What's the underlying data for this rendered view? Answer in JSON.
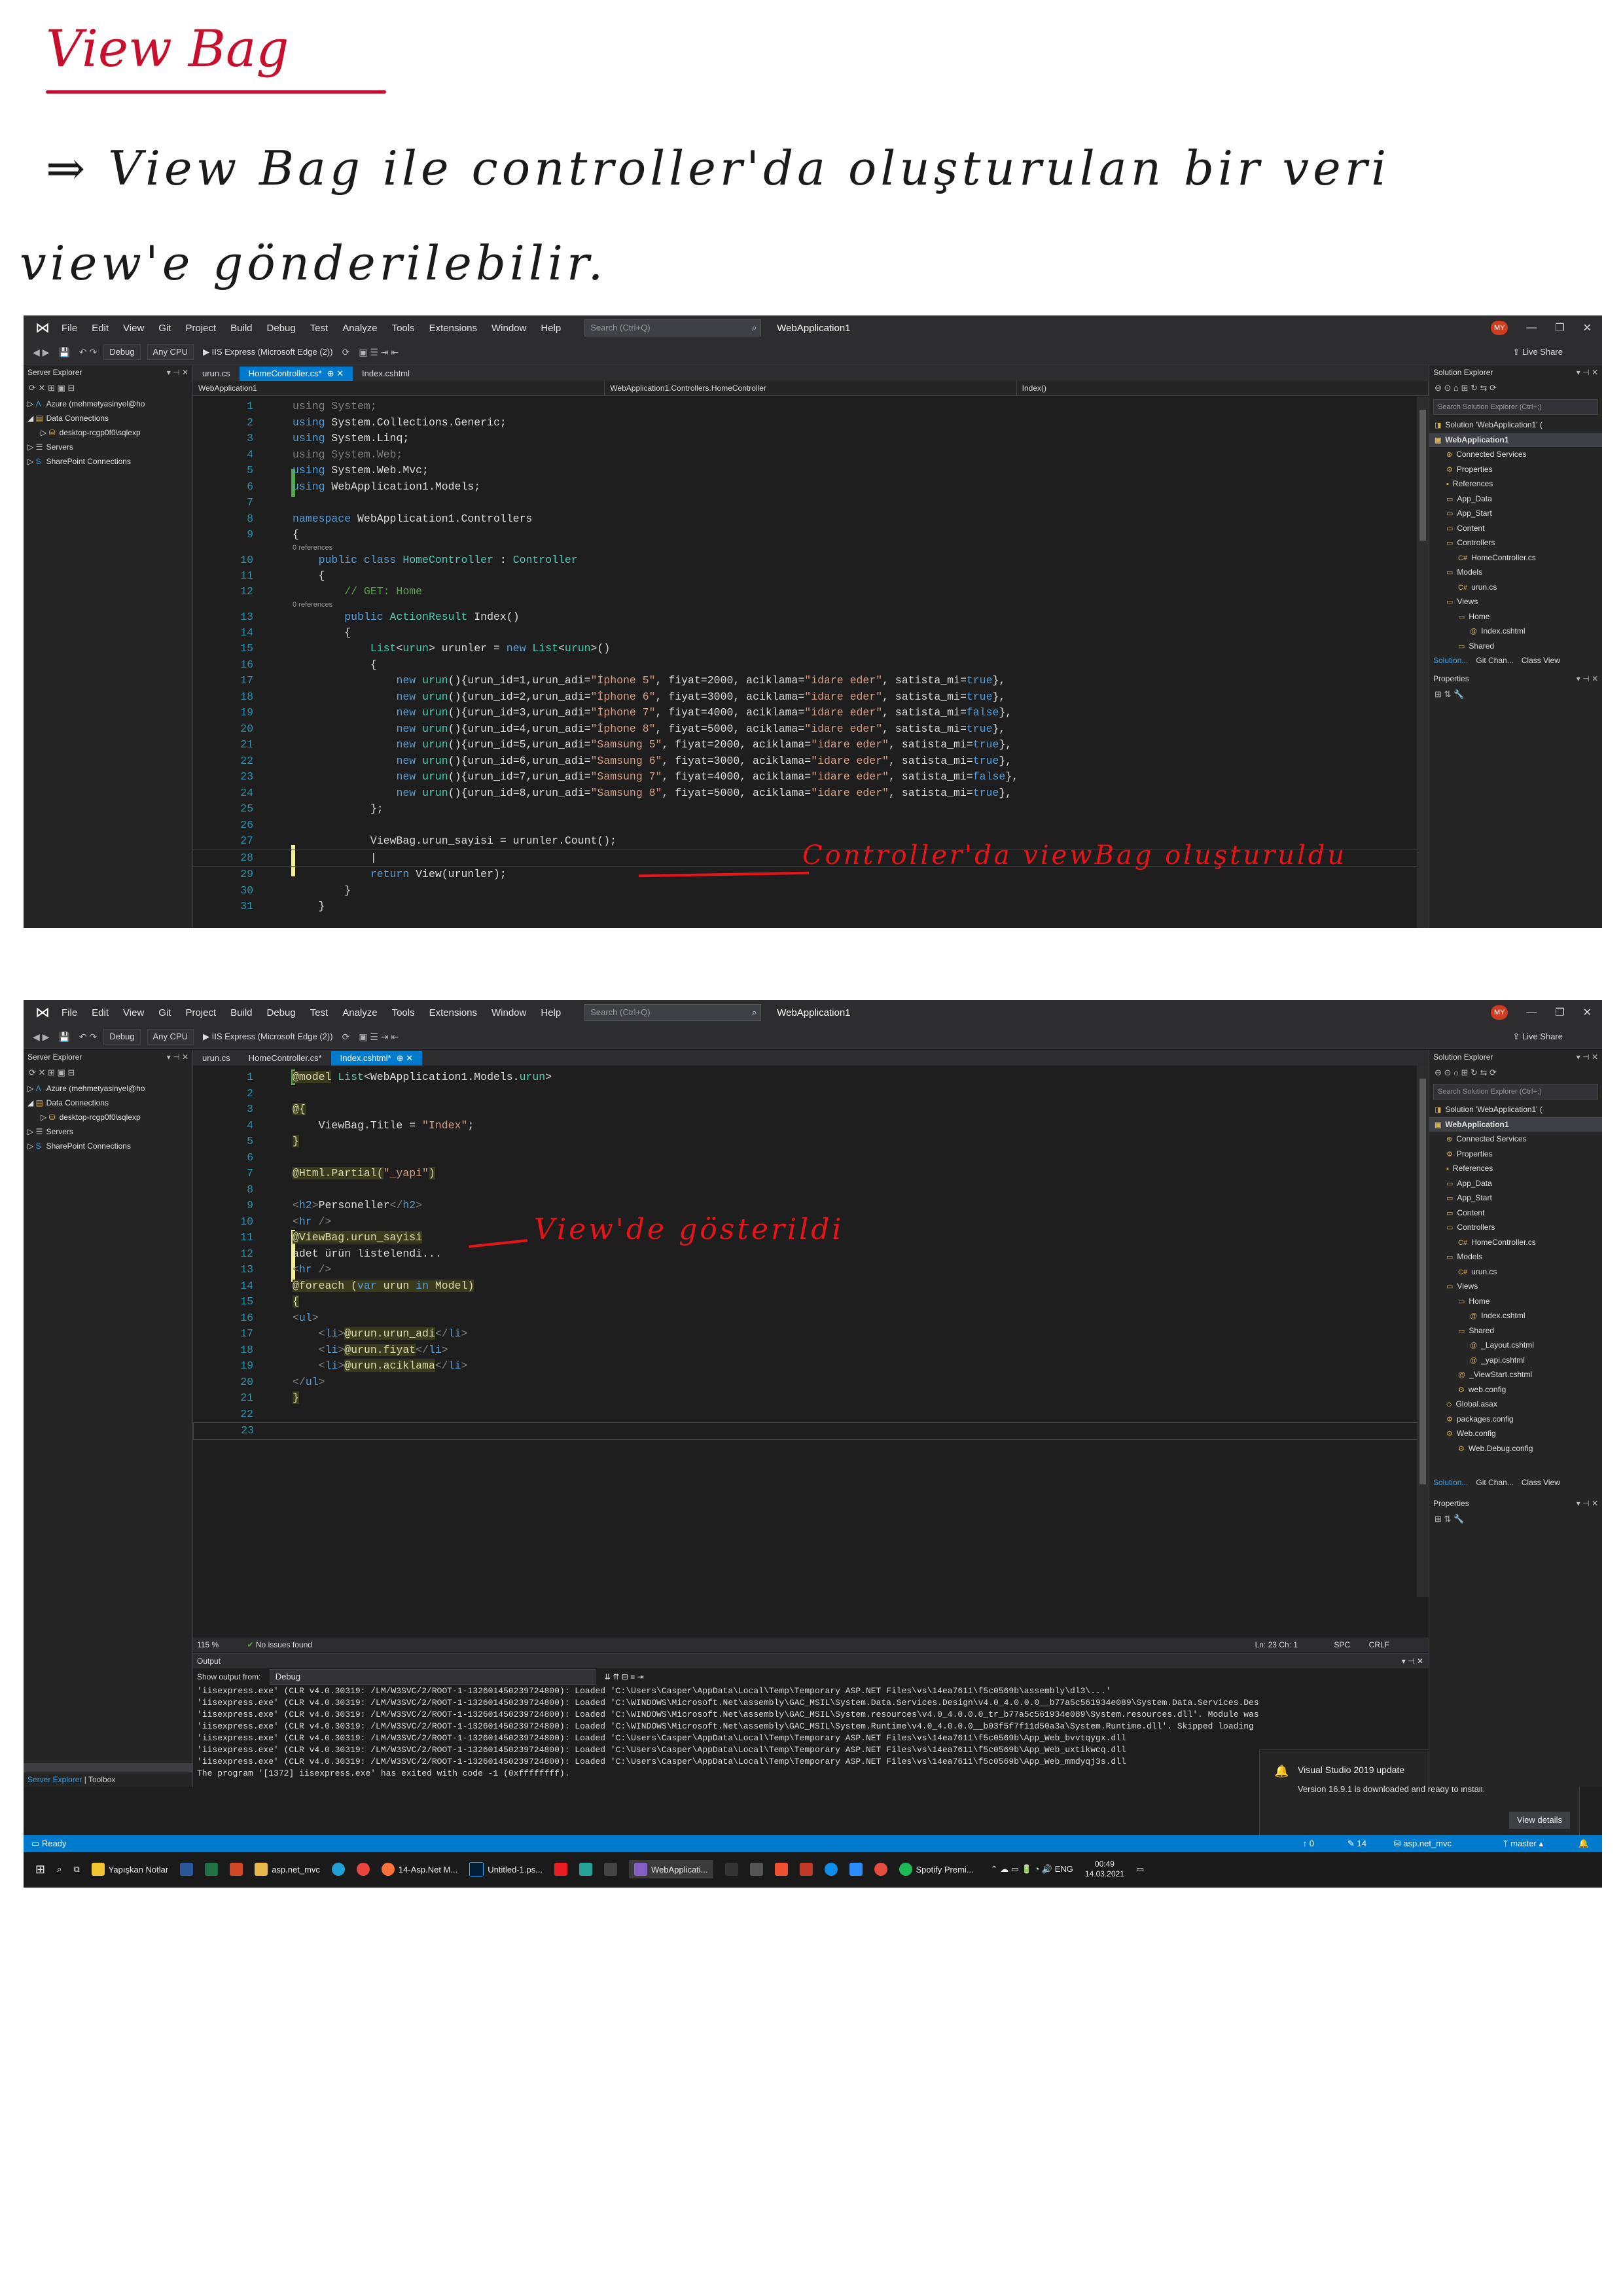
{
  "notes": {
    "title": "View Bag",
    "line1": "⇒ View Bag  ile   controller'da  oluşturulan  bir  veri",
    "line2": "view'e  gönderilebilir."
  },
  "menu": [
    "File",
    "Edit",
    "View",
    "Git",
    "Project",
    "Build",
    "Debug",
    "Test",
    "Analyze",
    "Tools",
    "Extensions",
    "Window",
    "Help"
  ],
  "search_placeholder": "Search (Ctrl+Q)",
  "app_title": "WebApplication1",
  "avatar": "MY",
  "toolbar": {
    "config": "Debug",
    "platform": "Any CPU",
    "run": "IIS Express (Microsoft Edge (2))",
    "live_share": "Live Share"
  },
  "server_explorer": {
    "title": "Server Explorer",
    "items": [
      "Azure (mehmetyasinyel@ho",
      "Data Connections",
      "desktop-rcgp0f0\\sqlexp",
      "Servers",
      "SharePoint Connections"
    ]
  },
  "solution_explorer": {
    "title": "Solution Explorer",
    "search": "Search Solution Explorer (Ctrl+;)",
    "items": [
      "Solution 'WebApplication1' (",
      "WebApplication1",
      "Connected Services",
      "Properties",
      "References",
      "App_Data",
      "App_Start",
      "Content",
      "Controllers",
      "HomeController.cs",
      "Models",
      "urun.cs",
      "Views",
      "Home",
      "Index.cshtml",
      "Shared",
      "_Layout.cshtml",
      "_yapi.cshtml",
      "_ViewStart.cshtml",
      "web.config",
      "Global.asax",
      "packages.config",
      "Web.config",
      "Web.Debug.config"
    ],
    "tabs": [
      "Solution...",
      "Git Chan...",
      "Class View"
    ],
    "properties": "Properties"
  },
  "window1": {
    "tabs": [
      "urun.cs",
      "HomeController.cs*",
      "Index.cshtml"
    ],
    "nav": [
      "WebApplication1",
      "WebApplication1.Controllers.HomeController",
      "Index()"
    ],
    "lines": [
      "using System;",
      "using System.Collections.Generic;",
      "using System.Linq;",
      "using System.Web;",
      "using System.Web.Mvc;",
      "using WebApplication1.Models;",
      "",
      "namespace WebApplication1.Controllers",
      "{",
      "    public class HomeController : Controller",
      "    {",
      "        // GET: Home",
      "        public ActionResult Index()",
      "        {",
      "            List<urun> urunler = new List<urun>()",
      "            {",
      "                new urun(){urun_id=1,urun_adi=\"İphone 5\", fiyat=2000, aciklama=\"idare eder\", satista_mi=true},",
      "                new urun(){urun_id=2,urun_adi=\"İphone 6\", fiyat=3000, aciklama=\"idare eder\", satista_mi=true},",
      "                new urun(){urun_id=3,urun_adi=\"İphone 7\", fiyat=4000, aciklama=\"idare eder\", satista_mi=false},",
      "                new urun(){urun_id=4,urun_adi=\"İphone 8\", fiyat=5000, aciklama=\"idare eder\", satista_mi=true},",
      "                new urun(){urun_id=5,urun_adi=\"Samsung 5\", fiyat=2000, aciklama=\"idare eder\", satista_mi=true},",
      "                new urun(){urun_id=6,urun_adi=\"Samsung 6\", fiyat=3000, aciklama=\"idare eder\", satista_mi=true},",
      "                new urun(){urun_id=7,urun_adi=\"Samsung 7\", fiyat=4000, aciklama=\"idare eder\", satista_mi=false},",
      "                new urun(){urun_id=8,urun_adi=\"Samsung 8\", fiyat=5000, aciklama=\"idare eder\", satista_mi=true},",
      "            };",
      "",
      "            ViewBag.urun_sayisi = urunler.Count();",
      "            |",
      "            return View(urunler);",
      "        }",
      "    }"
    ],
    "refs": "0 references",
    "annotation": "Controller'da  viewBag  oluşturuldu"
  },
  "window2": {
    "tabs": [
      "urun.cs",
      "HomeController.cs*",
      "Index.cshtml*"
    ],
    "lines": [
      "@model List<WebApplication1.Models.urun>",
      "",
      "@{",
      "    ViewBag.Title = \"Index\";",
      "}",
      "",
      "@Html.Partial(\"_yapi\")",
      "",
      "<h2>Personeller</h2>",
      "<hr />",
      "@ViewBag.urun_sayisi",
      "adet ürün listelendi...",
      "<hr />",
      "@foreach (var urun in Model)",
      "{",
      "<ul>",
      "    <li>@urun.urun_adi</li>",
      "    <li>@urun.fiyat</li>",
      "    <li>@urun.aciklama</li>",
      "</ul>",
      "}",
      "",
      ""
    ],
    "annotation": "View'de  gösterildi",
    "zoom": "115 %",
    "issues": "No issues found",
    "cursor": "Ln: 23   Ch: 1",
    "spc": "SPC",
    "crlf": "CRLF",
    "output": {
      "title": "Output",
      "show_from": "Show output from:",
      "source": "Debug",
      "lines": [
        "'iisexpress.exe' (CLR v4.0.30319: /LM/W3SVC/2/ROOT-1-132601450239724800): Loaded 'C:\\Users\\Casper\\AppData\\Local\\Temp\\Temporary ASP.NET Files\\vs\\14ea7611\\f5c0569b\\assembly\\dl3\\...'",
        "'iisexpress.exe' (CLR v4.0.30319: /LM/W3SVC/2/ROOT-1-132601450239724800): Loaded 'C:\\WINDOWS\\Microsoft.Net\\assembly\\GAC_MSIL\\System.Data.Services.Design\\v4.0_4.0.0.0__b77a5c561934e089\\System.Data.Services.Des",
        "'iisexpress.exe' (CLR v4.0.30319: /LM/W3SVC/2/ROOT-1-132601450239724800): Loaded 'C:\\WINDOWS\\Microsoft.Net\\assembly\\GAC_MSIL\\System.resources\\v4.0_4.0.0.0_tr_b77a5c561934e089\\System.resources.dll'. Module was",
        "'iisexpress.exe' (CLR v4.0.30319: /LM/W3SVC/2/ROOT-1-132601450239724800): Loaded 'C:\\WINDOWS\\Microsoft.Net\\assembly\\GAC_MSIL\\System.Runtime\\v4.0_4.0.0.0__b03f5f7f11d50a3a\\System.Runtime.dll'. Skipped loading",
        "'iisexpress.exe' (CLR v4.0.30319: /LM/W3SVC/2/ROOT-1-132601450239724800): Loaded 'C:\\Users\\Casper\\AppData\\Local\\Temp\\Temporary ASP.NET Files\\vs\\14ea7611\\f5c0569b\\App_Web_bvvtqygx.dll",
        "'iisexpress.exe' (CLR v4.0.30319: /LM/W3SVC/2/ROOT-1-132601450239724800): Loaded 'C:\\Users\\Casper\\AppData\\Local\\Temp\\Temporary ASP.NET Files\\vs\\14ea7611\\f5c0569b\\App_Web_uxtikwcq.dll",
        "'iisexpress.exe' (CLR v4.0.30319: /LM/W3SVC/2/ROOT-1-132601450239724800): Loaded 'C:\\Users\\Casper\\AppData\\Local\\Temp\\Temporary ASP.NET Files\\vs\\14ea7611\\f5c0569b\\App_Web_mmdyqj3s.dll",
        "The program '[1372] iisexpress.exe' has exited with code -1 (0xffffffff)."
      ]
    },
    "toast": {
      "title": "Visual Studio 2019 update",
      "body": "Version 16.9.1 is downloaded and ready to install.",
      "button": "View details"
    },
    "bottom_tabs": [
      "Server Explorer",
      "Toolbox"
    ],
    "status": {
      "ready": "Ready",
      "up": "↑ 0",
      "pencil": "✎ 14",
      "repo": "asp.net_mvc",
      "branch": "master",
      "bell": "🔔"
    },
    "taskbar": {
      "items": [
        "Yapışkan Notlar",
        "asp.net_mvc",
        "14-Asp.Net M...",
        "Untitled-1.ps...",
        "WebApplicati...",
        "Spotify Premi..."
      ],
      "time": "00:49",
      "date": "14.03.2021"
    }
  },
  "colors": {
    "accent": "#007acc",
    "annotation": "#e8141a",
    "editor_bg": "#1e1e1e"
  }
}
